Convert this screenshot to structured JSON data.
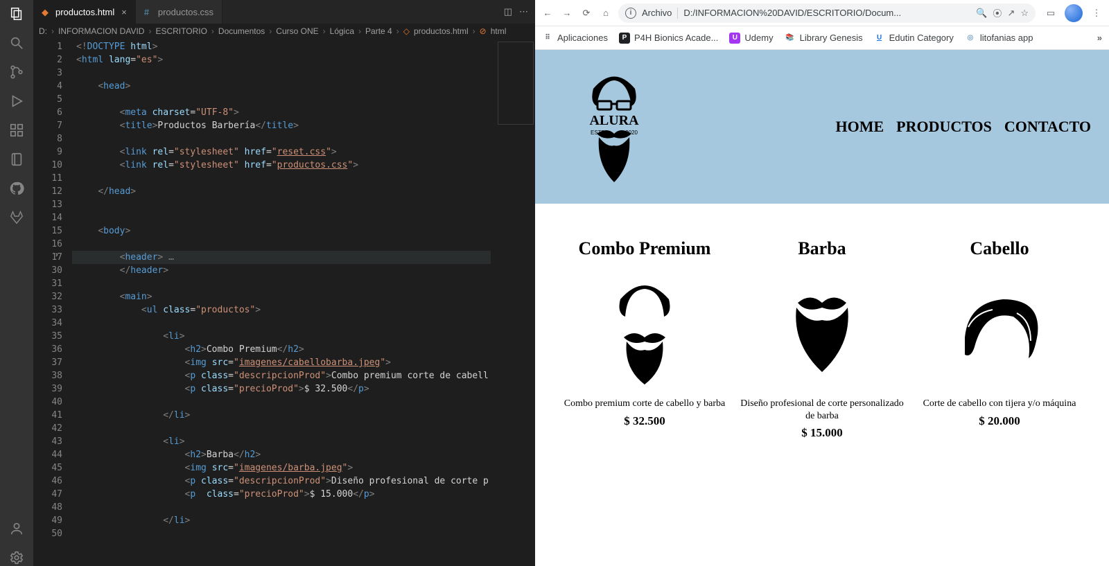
{
  "vscode": {
    "tabs": [
      {
        "label": "productos.html",
        "active": true,
        "icon": "html-file-icon",
        "close": "×"
      },
      {
        "label": "productos.css",
        "active": false,
        "icon": "css-file-icon",
        "close": ""
      }
    ],
    "breadcrumbs": [
      "D:",
      "INFORMACION DAVID",
      "ESCRITORIO",
      "Documentos",
      "Curso ONE",
      "Lógica",
      "Parte 4",
      "",
      "productos.html",
      "html"
    ],
    "line_numbers": [
      "1",
      "2",
      "3",
      "4",
      "5",
      "6",
      "7",
      "8",
      "9",
      "10",
      "11",
      "12",
      "13",
      "14",
      "15",
      "16",
      "17",
      "30",
      "31",
      "32",
      "33",
      "34",
      "35",
      "36",
      "37",
      "38",
      "39",
      "40",
      "41",
      "42",
      "43",
      "44",
      "45",
      "46",
      "47",
      "48",
      "49",
      "50"
    ],
    "fold_line": "17"
  },
  "chrome": {
    "omnibox_prefix": "Archivo",
    "omnibox_url": "D:/INFORMACION%20DAVID/ESCRITORIO/Docum...",
    "bookmarks": [
      {
        "label": "Aplicaciones",
        "icon_bg": "#ffffff",
        "icon_txt": "⠿",
        "icon_color": "#5f6368"
      },
      {
        "label": "P4H Bionics Acade...",
        "icon_bg": "#202124",
        "icon_txt": "P"
      },
      {
        "label": "Udemy",
        "icon_bg": "#a435f0",
        "icon_txt": "U"
      },
      {
        "label": "Library Genesis",
        "icon_bg": "#ffffff",
        "icon_txt": "📚",
        "icon_color": "#1a73e8"
      },
      {
        "label": "Edutin Category",
        "icon_bg": "#ffffff",
        "icon_txt": "U",
        "icon_color": "#1a73e8",
        "underline": true
      },
      {
        "label": "litofanias app",
        "icon_bg": "#ffffff",
        "icon_txt": "◎",
        "icon_color": "#7aa2c4"
      }
    ]
  },
  "page": {
    "logo_text_top": "ALURA",
    "logo_text_left": "ESTD",
    "logo_text_right": "2020",
    "nav": [
      "HOME",
      "PRODUCTOS",
      "CONTACTO"
    ],
    "products": [
      {
        "title": "Combo Premium",
        "desc": "Combo premium corte de cabello y barba",
        "price": "$ 32.500"
      },
      {
        "title": "Barba",
        "desc": "Diseño profesional de corte personalizado de barba",
        "price": "$ 15.000"
      },
      {
        "title": "Cabello",
        "desc": "Corte de cabello con tijera y/o máquina",
        "price": "$ 20.000"
      }
    ]
  }
}
